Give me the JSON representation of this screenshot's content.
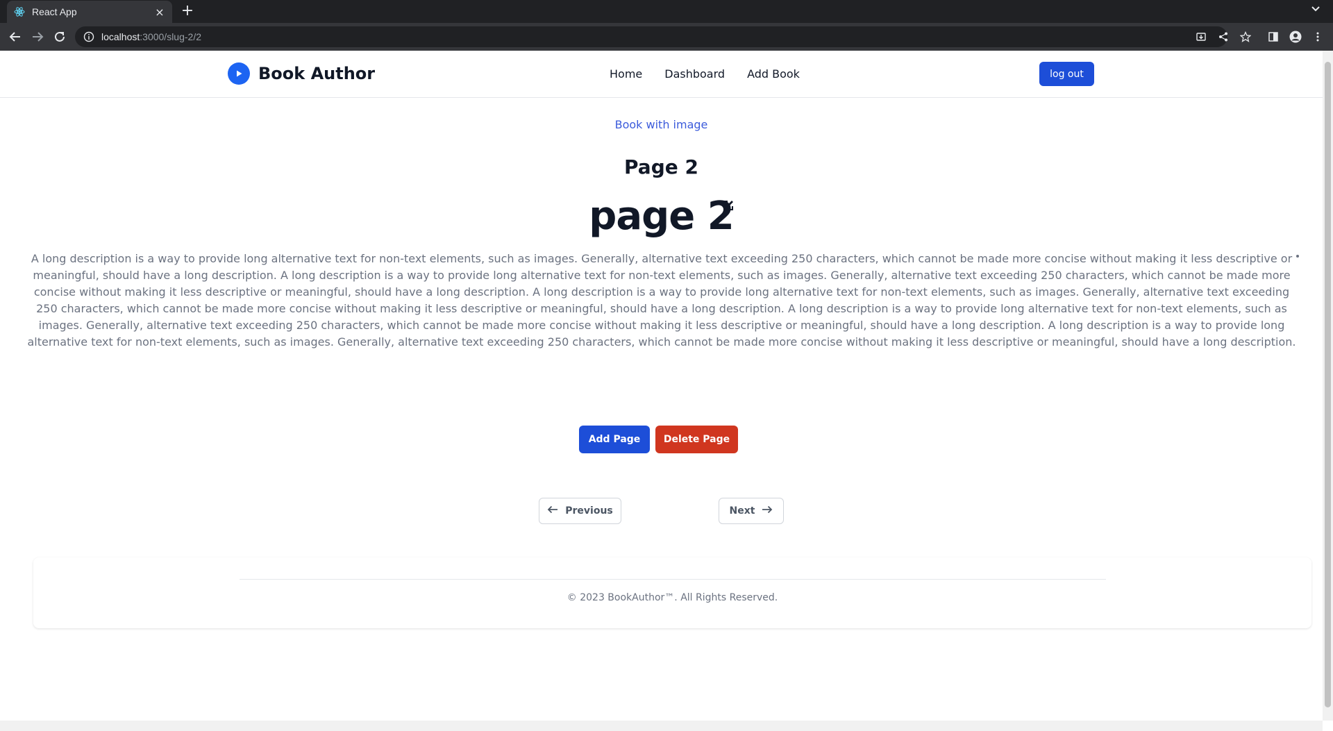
{
  "browser": {
    "tab_title": "React App",
    "tab_close": "×",
    "new_tab": "+",
    "url_host": "localhost",
    "url_path": ":3000/slug-2/2"
  },
  "header": {
    "brand_name": "Book Author",
    "nav": {
      "home": "Home",
      "dashboard": "Dashboard",
      "add_book": "Add Book"
    },
    "logout_label": "log out"
  },
  "content": {
    "book_link": "Book with image",
    "page_heading": "Page 2",
    "page_title": "page 2",
    "description": "A long description is a way to provide long alternative text for non-text elements, such as images. Generally, alternative text exceeding 250 characters, which cannot be made more concise without making it less descriptive or meaningful, should have a long description. A long description is a way to provide long alternative text for non-text elements, such as images. Generally, alternative text exceeding 250 characters, which cannot be made more concise without making it less descriptive or meaningful, should have a long description. A long description is a way to provide long alternative text for non-text elements, such as images. Generally, alternative text exceeding 250 characters, which cannot be made more concise without making it less descriptive or meaningful, should have a long description. A long description is a way to provide long alternative text for non-text elements, such as images. Generally, alternative text exceeding 250 characters, which cannot be made more concise without making it less descriptive or meaningful, should have a long description. A long description is a way to provide long alternative text for non-text elements, such as images. Generally, alternative text exceeding 250 characters, which cannot be made more concise without making it less descriptive or meaningful, should have a long description.",
    "add_page_label": "Add Page",
    "delete_page_label": "Delete Page",
    "previous_label": "Previous",
    "next_label": "Next"
  },
  "footer": {
    "copyright": "© 2023 BookAuthor™. All Rights Reserved."
  },
  "colors": {
    "primary": "#1d4ed8",
    "danger": "#d0361f",
    "link": "#3b5bdb",
    "text_dark": "#111827",
    "text_muted": "#6b7280"
  },
  "icons": {
    "favicon": "react-icon",
    "brand_logo": "play-circle-icon",
    "edit": "edit-icon",
    "previous": "arrow-left-icon",
    "next": "arrow-right-icon"
  }
}
